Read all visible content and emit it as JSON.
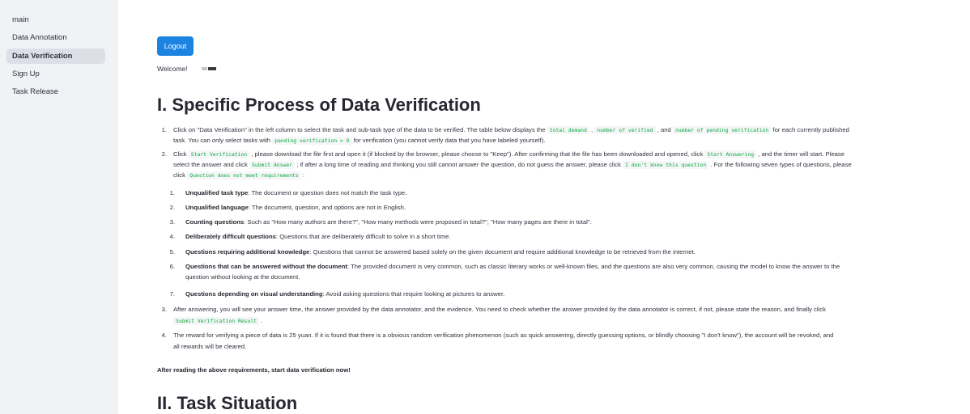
{
  "sidebar": {
    "items": [
      {
        "label": "main",
        "active": false
      },
      {
        "label": "Data Annotation",
        "active": false
      },
      {
        "label": "Data Verification",
        "active": true
      },
      {
        "label": "Sign Up",
        "active": false
      },
      {
        "label": "Task Release",
        "active": false
      }
    ]
  },
  "header": {
    "logout_label": "Logout",
    "welcome_label": "Welcome!"
  },
  "section1": {
    "title": "I. Specific Process of Data Verification",
    "item1": {
      "text_a": "Click on \"Data Verification\" in the left column to select the task and sub-task type of the data to be verified. The table below displays the ",
      "code_a": "total demand",
      "text_b": " , ",
      "code_b": "number of verified",
      "text_c": " , and ",
      "code_c": "number of pending verification",
      "text_d": " for each currently published",
      "line2_a": "task. You can only select tasks with ",
      "code_d": "pending verification > 0",
      "line2_b": " for verification (you cannot verify data that you have labeled yourself)."
    },
    "item2": {
      "line1_a": "Click ",
      "code_a": "Start Verification",
      "line1_b": " , please download the file first and open it (if blocked by the browser, please choose to \"Keep\"). After confirming that the file has been downloaded and opened, click ",
      "code_b": "Start Answering",
      "line1_c": " , and the timer will start. Please",
      "line2_a": "select the answer and click ",
      "code_c": "Submit Answer",
      "line2_b": " ; if after a long time of reading and thinking you still cannot answer the question, do not guess the answer, please click ",
      "code_d": "I don't know this question",
      "line2_c": " . For the following seven types of questions, please",
      "line3_a": "click ",
      "code_e": "Question does not meet requirements",
      "line3_b": " :",
      "sub": [
        {
          "num": "1.",
          "bold": "Unqualified task type",
          "text": ": The document or question does not match the task type."
        },
        {
          "num": "2.",
          "bold": "Unqualified language",
          "text": ": The document, question, and options are not in English."
        },
        {
          "num": "3.",
          "bold": "Counting questions",
          "text": ": Such as \"How many authors are there?\", \"How many methods were proposed in total?\", \"How many pages are there in total\"."
        },
        {
          "num": "4.",
          "bold": "Deliberately difficult questions",
          "text": ": Questions that are deliberately difficult to solve in a short time."
        },
        {
          "num": "5.",
          "bold": "Questions requiring additional knowledge",
          "text": ": Questions that cannot be answered based solely on the given document and require additional knowledge to be retrieved from the internet."
        },
        {
          "num": "6.",
          "bold": "Questions that can be answered without the document",
          "text": ": The provided document is very common, such as classic literary works or well-known files, and the questions are also very common, causing the model to know the answer to the",
          "cont": "question without looking at the document."
        },
        {
          "num": "7.",
          "bold": "Questions depending on visual understanding",
          "text": ": Avoid asking questions that require looking at pictures to answer."
        }
      ]
    },
    "item3": {
      "line1": "After answering, you will see your answer time, the answer provided by the data annotator, and the evidence. You need to check whether the answer provided by the data annotator is correct, if not, please state the reason, and finally click",
      "code_a": "Submit Verification Result",
      "line2_b": " ."
    },
    "item4": {
      "line1": "The reward for verifying a piece of data is 25 yuan. If it is found that there is a obvious random verification phenomenon (such as quick answering, directly guessing options, or blindly choosing \"I don't know\"), the account will be revoked, and",
      "line2": "all rewards will be cleared."
    },
    "nums": [
      "1.",
      "2.",
      "3.",
      "4."
    ],
    "final_note": "After reading the above requirements, start data verification now!"
  },
  "section2": {
    "title": "II. Task Situation"
  }
}
